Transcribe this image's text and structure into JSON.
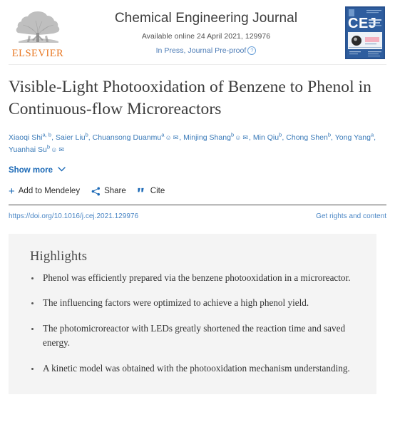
{
  "header": {
    "publisher_name": "ELSEVIER",
    "publisher_logo_icon": "elsevier-tree-logo",
    "journal_title": "Chemical Engineering Journal",
    "availability": "Available online 24 April 2021, 129976",
    "press_status": "In Press, Journal Pre-proof",
    "info_icon": "question-mark-circle-icon",
    "cover_icon": "journal-cover-thumbnail",
    "cover_text": "CEJ"
  },
  "article": {
    "title": "Visible-Light Photooxidation of Benzene to Phenol in Continuous-flow Microreactors",
    "authors": [
      {
        "name": "Xiaoqi Shi",
        "affiliations": "a, b",
        "has_author_icon": false,
        "has_mail_icon": false,
        "trailing": ","
      },
      {
        "name": "Saier Liu",
        "affiliations": "b",
        "has_author_icon": false,
        "has_mail_icon": false,
        "trailing": ","
      },
      {
        "name": "Chuansong Duanmu",
        "affiliations": "a",
        "has_author_icon": true,
        "has_mail_icon": true,
        "trailing": ","
      },
      {
        "name": "Minjing Shang",
        "affiliations": "b",
        "has_author_icon": true,
        "has_mail_icon": true,
        "trailing": ","
      },
      {
        "name": "Min Qiu",
        "affiliations": "b",
        "has_author_icon": false,
        "has_mail_icon": false,
        "trailing": ","
      },
      {
        "name": "Chong Shen",
        "affiliations": "b",
        "has_author_icon": false,
        "has_mail_icon": false,
        "trailing": ","
      },
      {
        "name": "Yong Yang",
        "affiliations": "a",
        "has_author_icon": false,
        "has_mail_icon": false,
        "trailing": ","
      },
      {
        "name": "Yuanhai Su",
        "affiliations": "b",
        "has_author_icon": true,
        "has_mail_icon": true,
        "trailing": ""
      }
    ],
    "author_person_icon": "person-icon",
    "author_mail_icon": "envelope-icon",
    "show_more_label": "Show more",
    "show_more_icon": "chevron-down-icon",
    "actions": [
      {
        "label": "Add to Mendeley",
        "icon": "plus-icon"
      },
      {
        "label": "Share",
        "icon": "share-nodes-icon"
      },
      {
        "label": "Cite",
        "icon": "quote-marks-icon"
      }
    ],
    "doi": "https://doi.org/10.1016/j.cej.2021.129976",
    "rights_link": "Get rights and content"
  },
  "highlights": {
    "heading": "Highlights",
    "items": [
      "Phenol was efficiently prepared via the benzene photooxidation in a microreactor.",
      "The influencing factors were optimized to achieve a high phenol yield.",
      "The photomicroreactor with LEDs greatly shortened the reaction time and saved energy.",
      "A kinetic model was obtained with the photooxidation mechanism understanding."
    ]
  },
  "colors": {
    "link_blue": "#1b69b6",
    "author_blue": "#3a7ab8",
    "elsevier_orange": "#e87722",
    "panel_gray": "#f4f4f4",
    "title_gray": "#3c3c3c"
  }
}
